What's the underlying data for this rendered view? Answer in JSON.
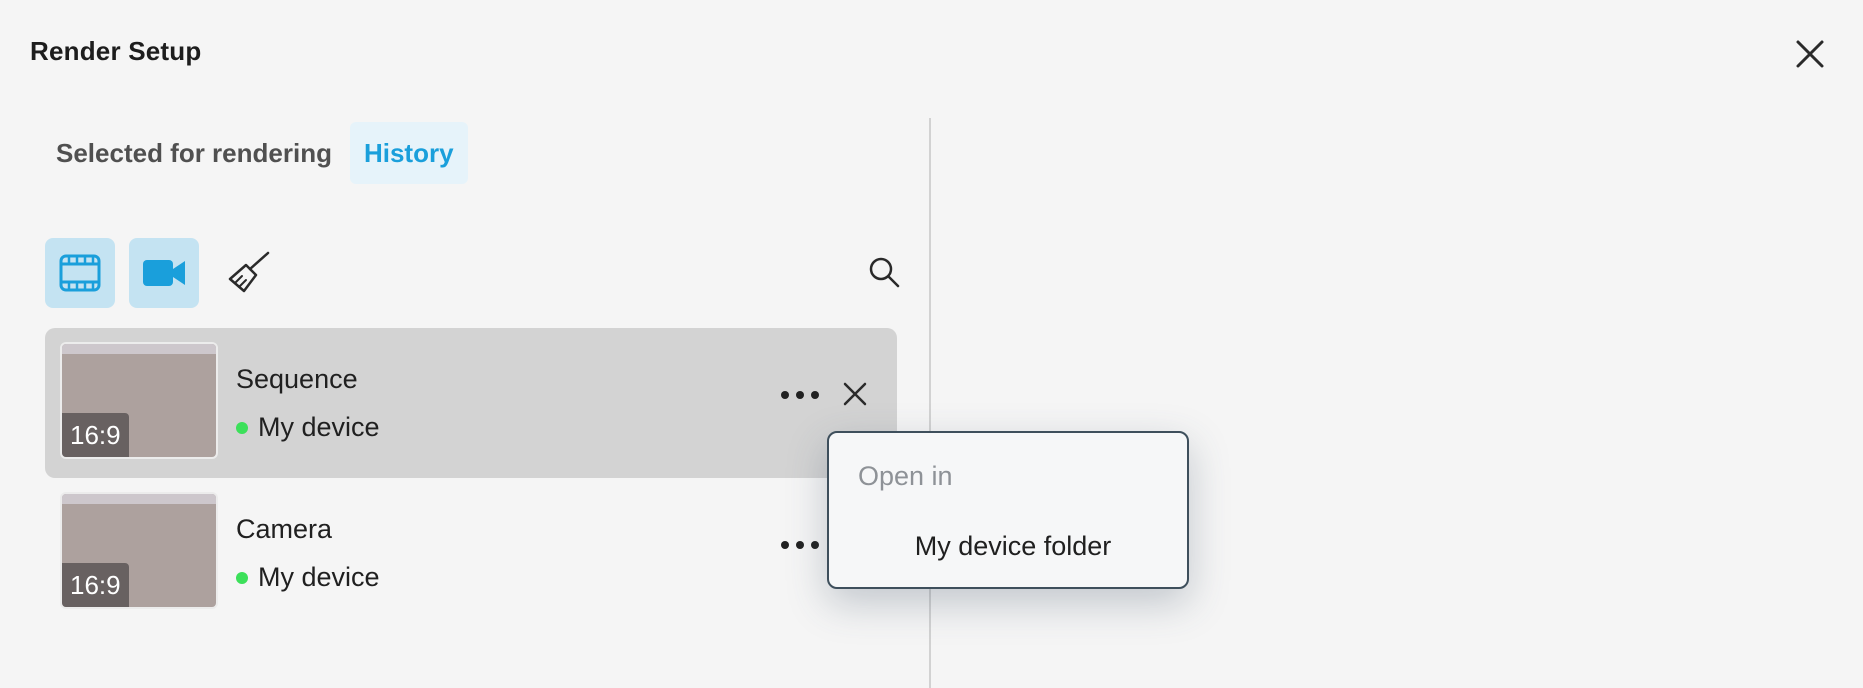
{
  "dialog": {
    "title": "Render Setup"
  },
  "tabs": [
    {
      "label": "Selected for rendering",
      "active": false
    },
    {
      "label": "History",
      "active": true
    }
  ],
  "toolbar": {
    "buttons": [
      {
        "icon": "film-strip-icon",
        "active": true
      },
      {
        "icon": "video-camera-icon",
        "active": true
      },
      {
        "icon": "broom-icon",
        "active": false
      }
    ],
    "search_icon": "search-icon"
  },
  "items": [
    {
      "name": "Sequence",
      "aspect": "16:9",
      "location": "My device",
      "status_color": "#3ce05a",
      "selected": true
    },
    {
      "name": "Camera",
      "aspect": "16:9",
      "location": "My device",
      "status_color": "#3ce05a",
      "selected": false
    }
  ],
  "context_menu": {
    "header": "Open in",
    "items": [
      {
        "label": "My device folder"
      }
    ]
  },
  "colors": {
    "accent": "#1a9fdb",
    "toolbar_active_bg": "#c4e3f2",
    "selected_row_bg": "#d3d3d3",
    "status_online": "#3ce05a"
  }
}
